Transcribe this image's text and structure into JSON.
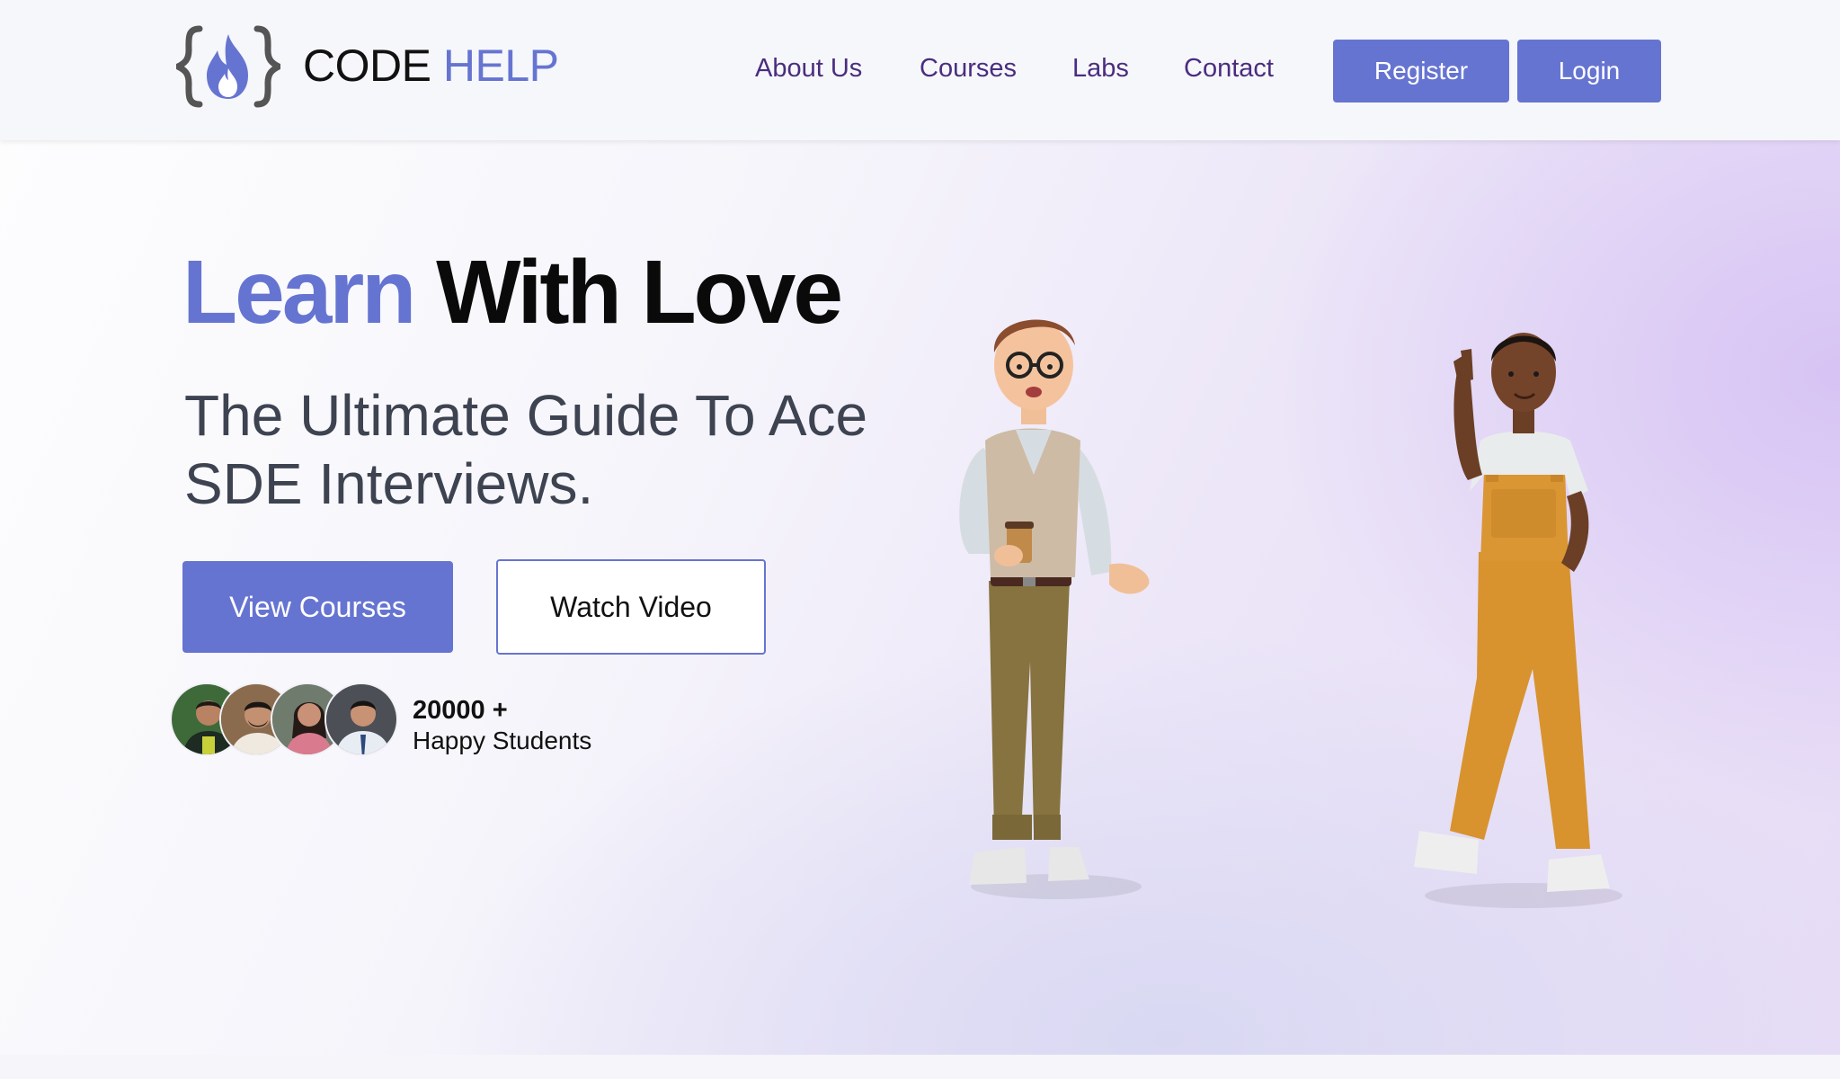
{
  "brand": {
    "name_part1": "CODE",
    "name_part2": "HELP",
    "logo_icon": "flame-braces-icon",
    "accent_color": "#6674d1"
  },
  "nav": {
    "links": [
      "About Us",
      "Courses",
      "Labs",
      "Contact"
    ],
    "register_label": "Register",
    "login_label": "Login"
  },
  "hero": {
    "headline_accent": "Learn",
    "headline_rest": "With Love",
    "subtitle": "The Ultimate Guide To Ace SDE Interviews.",
    "primary_cta": "View Courses",
    "secondary_cta": "Watch Video",
    "students_count": "20000 +",
    "students_label": "Happy Students",
    "avatar_count": 4,
    "illustrations": [
      "man-holding-coffee-illustration",
      "woman-peace-sign-illustration"
    ]
  }
}
